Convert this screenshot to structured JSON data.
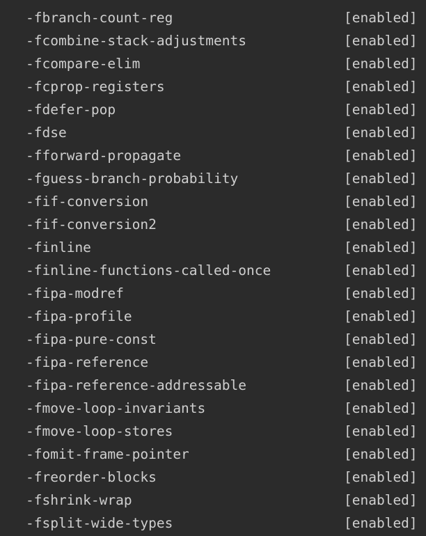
{
  "terminal": {
    "options": [
      {
        "flag": "-fbranch-count-reg",
        "status": "[enabled]"
      },
      {
        "flag": "-fcombine-stack-adjustments",
        "status": "[enabled]"
      },
      {
        "flag": "-fcompare-elim",
        "status": "[enabled]"
      },
      {
        "flag": "-fcprop-registers",
        "status": "[enabled]"
      },
      {
        "flag": "-fdefer-pop",
        "status": "[enabled]"
      },
      {
        "flag": "-fdse",
        "status": "[enabled]"
      },
      {
        "flag": "-fforward-propagate",
        "status": "[enabled]"
      },
      {
        "flag": "-fguess-branch-probability",
        "status": "[enabled]"
      },
      {
        "flag": "-fif-conversion",
        "status": "[enabled]"
      },
      {
        "flag": "-fif-conversion2",
        "status": "[enabled]"
      },
      {
        "flag": "-finline",
        "status": "[enabled]"
      },
      {
        "flag": "-finline-functions-called-once",
        "status": "[enabled]"
      },
      {
        "flag": "-fipa-modref",
        "status": "[enabled]"
      },
      {
        "flag": "-fipa-profile",
        "status": "[enabled]"
      },
      {
        "flag": "-fipa-pure-const",
        "status": "[enabled]"
      },
      {
        "flag": "-fipa-reference",
        "status": "[enabled]"
      },
      {
        "flag": "-fipa-reference-addressable",
        "status": "[enabled]"
      },
      {
        "flag": "-fmove-loop-invariants",
        "status": "[enabled]"
      },
      {
        "flag": "-fmove-loop-stores",
        "status": "[enabled]"
      },
      {
        "flag": "-fomit-frame-pointer",
        "status": "[enabled]"
      },
      {
        "flag": "-freorder-blocks",
        "status": "[enabled]"
      },
      {
        "flag": "-fshrink-wrap",
        "status": "[enabled]"
      },
      {
        "flag": "-fsplit-wide-types",
        "status": "[enabled]"
      }
    ]
  }
}
